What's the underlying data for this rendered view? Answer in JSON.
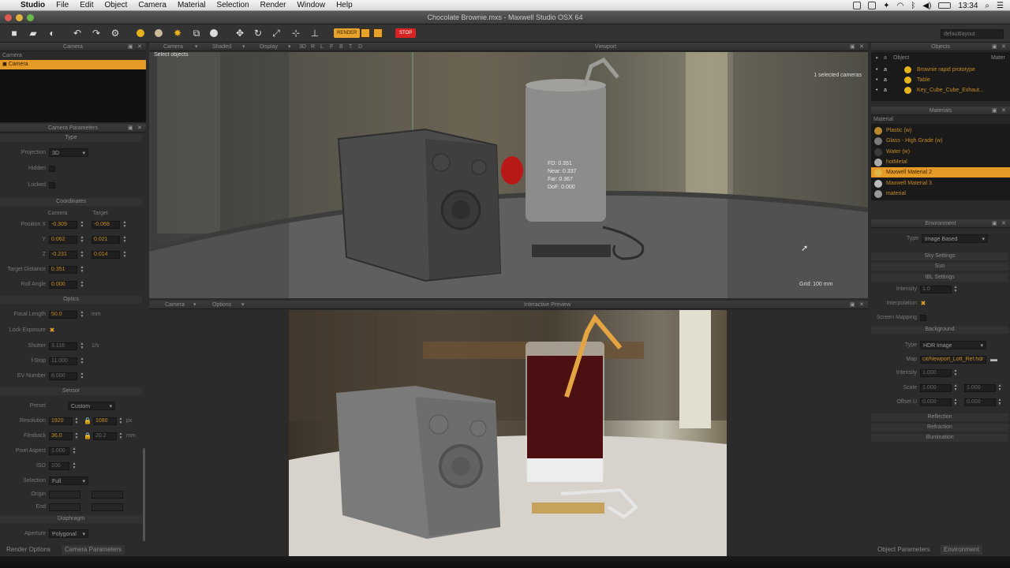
{
  "menubar": {
    "items": [
      "Studio",
      "File",
      "Edit",
      "Object",
      "Camera",
      "Material",
      "Selection",
      "Render",
      "Window",
      "Help"
    ],
    "clock": "13:34"
  },
  "window": {
    "title": "Chocolate Brownie.mxs - Maxwell Studio  OSX 64"
  },
  "toolbar": {
    "render_label": "RENDER",
    "stop_label": "STOP",
    "layout_value": "defaultlayout"
  },
  "camera_panel": {
    "title": "Camera",
    "column": "Camera",
    "items": [
      "Camera"
    ]
  },
  "camera_params": {
    "title": "Camera Parameters",
    "type_section": "Type",
    "projection_label": "Projection",
    "projection_value": "3D",
    "hidden_label": "Hidden",
    "locked_label": "Locked",
    "coordinates_section": "Coordinates",
    "col_camera": "Camera",
    "col_target": "Target",
    "pos_x_label": "Position X",
    "pos_x_cam": "-0.309",
    "pos_x_tgt": "-0.068",
    "pos_y_label": "Y",
    "pos_y_cam": "0.062",
    "pos_y_tgt": "0.021",
    "pos_z_label": "Z",
    "pos_z_cam": "-0.231",
    "pos_z_tgt": "0.014",
    "target_distance_label": "Target Distance",
    "target_distance": "0.351",
    "roll_angle_label": "Roll Angle",
    "roll_angle": "0.000",
    "optics_section": "Optics",
    "focal_length_label": "Focal Length",
    "focal_length": "50.0",
    "focal_unit": "mm",
    "lock_exposure_label": "Lock Exposure",
    "shutter_label": "Shutter",
    "shutter": "3.116",
    "shutter_unit": "1/s",
    "fstop_label": "f-Stop",
    "fstop": "11.000",
    "ev_label": "EV Number",
    "ev": "8.000",
    "sensor_section": "Sensor",
    "preset_label": "Preset",
    "preset": "Custom",
    "resolution_label": "Resolution",
    "res_w": "1920",
    "res_h": "1080",
    "res_unit": "px",
    "filmback_label": "Filmback",
    "film_w": "36.0",
    "film_h": "20.2",
    "film_unit": "mm",
    "pixel_aspect_label": "Pixel Aspect",
    "pixel_aspect": "1.000",
    "iso_label": "ISO",
    "iso": "100",
    "selection_label": "Selection",
    "selection": "Full",
    "origin_label": "Origin",
    "end_label": "End",
    "diaphragm_section": "Diaphragm",
    "aperture_label": "Aperture",
    "aperture": "Polygonal"
  },
  "bottom_tabs": {
    "left": [
      "Render Options",
      "Camera Parameters"
    ],
    "right": [
      "Object Parameters",
      "Environment"
    ]
  },
  "viewport": {
    "title": "Viewport",
    "menus": [
      "Camera",
      "Shaded",
      "Display"
    ],
    "view_buttons": [
      "3D",
      "R",
      "L",
      "F",
      "B",
      "T",
      "D"
    ],
    "status": "Select objects",
    "selected": "1 selected cameras",
    "focus_info": [
      "FD: 0.351",
      "Near: 0.337",
      "Far: 0.367",
      "DoF: 0.000"
    ],
    "grid": "Grid: 100 mm"
  },
  "preview": {
    "title": "Interactive Preview",
    "menus": [
      "Camera",
      "Options"
    ]
  },
  "objects_panel": {
    "title": "Objects",
    "col_object": "Object",
    "col_material": "Mater",
    "items": [
      "Brownie rapid prototype",
      "Table",
      "Key_Cube_Cube_Exhaut..."
    ]
  },
  "materials_panel": {
    "title": "Materials",
    "col": "Material",
    "items": [
      "Plastic (w)",
      "Glass - High Grade (w)",
      "Water (w)",
      "hotMetal",
      "Maxwell Material 2",
      "Maxwell Material 3",
      "material"
    ],
    "selected_index": 4,
    "ball_colors": [
      "#b9892f",
      "#7a7a7a",
      "#3a3a3a",
      "#aaaaaa",
      "#e0b24a",
      "#bbbbbb",
      "#999999"
    ]
  },
  "env_params": {
    "title": "Environment",
    "type_label": "Type",
    "type_value": "Image Based",
    "sky_settings": "Sky Settings",
    "sun": "Sun",
    "ibl_settings": "IBL Settings",
    "intensity_label": "Intensity",
    "intensity": "1.0",
    "interpolation_label": "Interpolation",
    "screen_mapping_label": "Screen Mapping",
    "background_section": "Background",
    "bg_type_label": "Type",
    "bg_type": "HDR Image",
    "map_label": "Map",
    "map_value": "cit/Newport_Loft_Ref.hdr",
    "bg_intensity_label": "Intensity",
    "bg_intensity": "1.000",
    "scale_label": "Scale",
    "scale_u": "1.000",
    "scale_v": "1.000",
    "offset_label": "Offset U",
    "offset_u": "0.000",
    "offset_v": "0.000",
    "reflection": "Reflection",
    "refraction": "Refraction",
    "illumination": "Illumination"
  }
}
